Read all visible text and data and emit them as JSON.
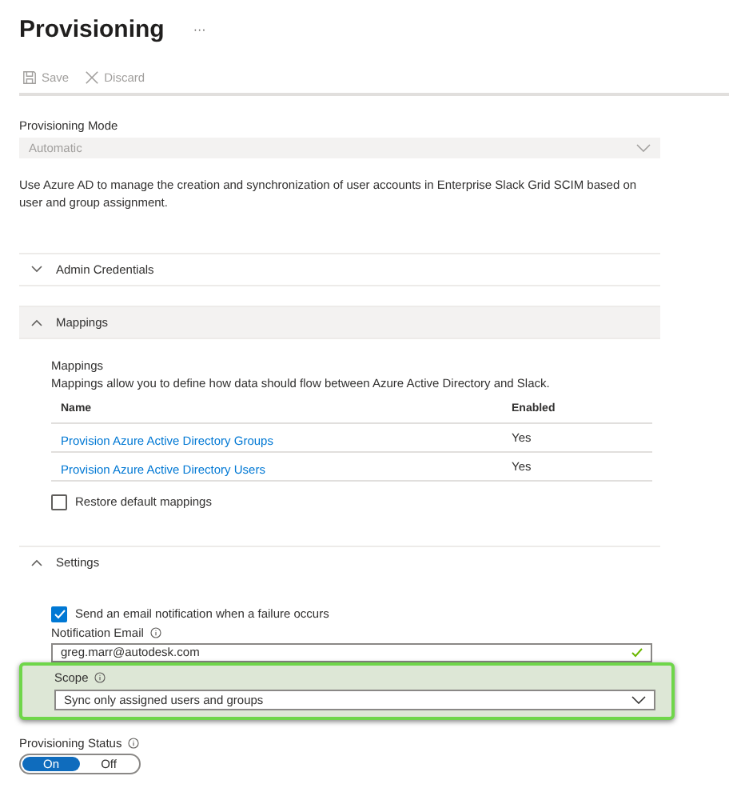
{
  "title": "Provisioning",
  "more": "···",
  "toolbar": [
    {
      "kind": "save",
      "label": "Save",
      "disabled": true
    },
    {
      "kind": "discard",
      "label": "Discard",
      "disabled": true
    }
  ],
  "mode": {
    "label": "Provisioning Mode",
    "value": "Automatic",
    "disabled": true
  },
  "description": "Use Azure AD to manage the creation and synchronization of user accounts in Enterprise Slack Grid SCIM based on user and group assignment.",
  "sections": [
    {
      "title": "Admin Credentials",
      "expanded": false
    },
    {
      "kind": "mappings",
      "title": "Mappings",
      "expanded": true
    },
    {
      "kind": "settings",
      "title": "Settings",
      "expanded": true
    }
  ],
  "mappings": {
    "heading": "Mappings",
    "text": "Mappings allow you to define how data should flow between Azure Active Directory and Slack.",
    "columns": [
      "Name",
      "Enabled"
    ],
    "rows": [
      {
        "name": "Provision Azure Active Directory Groups",
        "enabled": "Yes"
      },
      {
        "name": "Provision Azure Active Directory Users",
        "enabled": "Yes"
      }
    ],
    "restore": {
      "label": "Restore default mappings",
      "checked": false
    }
  },
  "settings": {
    "notify": {
      "label": "Send an email notification when a failure occurs",
      "checked": true
    },
    "email": {
      "label": "Notification Email",
      "value": "greg.marr@autodesk.com",
      "valid": true
    },
    "scope": {
      "label": "Scope",
      "value": "Sync only assigned users and groups",
      "highlighted": true
    }
  },
  "status": {
    "label": "Provisioning Status",
    "options": [
      {
        "label": "On",
        "selected": true
      },
      {
        "label": "Off",
        "selected": false
      }
    ]
  }
}
